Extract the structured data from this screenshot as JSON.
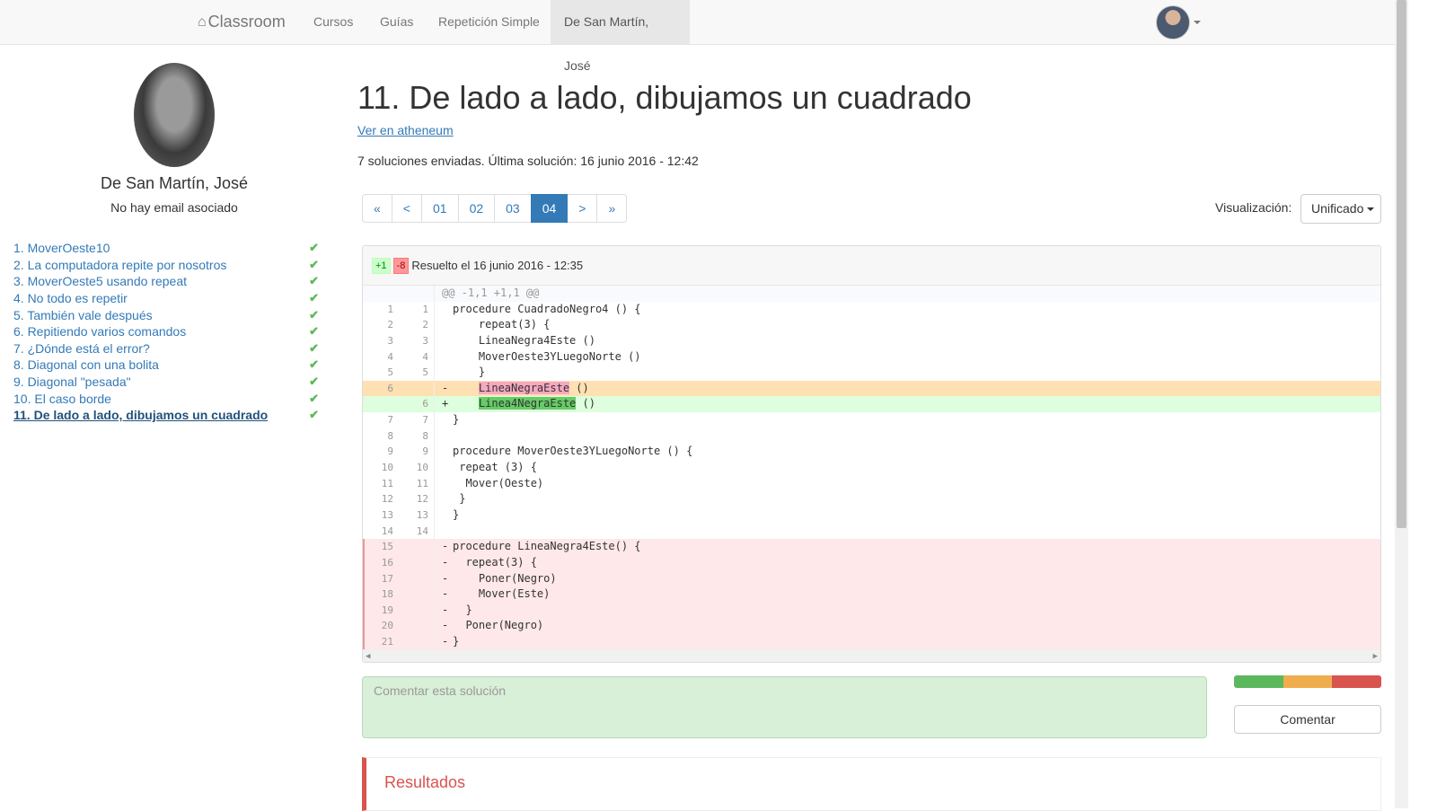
{
  "navbar": {
    "brand": "Classroom",
    "items": [
      "Cursos",
      "Guías",
      "Repetición Simple",
      "De San Martín, José"
    ]
  },
  "profile": {
    "name": "De San Martín, José",
    "email": "No hay email asociado"
  },
  "exercises": [
    "1. MoverOeste10",
    "2. La computadora repite por nosotros",
    "3. MoverOeste5 usando repeat",
    "4. No todo es repetir",
    "5. También vale después",
    "6. Repitiendo varios comandos",
    "7. ¿Dónde está el error?",
    "8. Diagonal con una bolita",
    "9. Diagonal \"pesada\"",
    "10. El caso borde",
    "11. De lado a lado, dibujamos un cuadrado"
  ],
  "main": {
    "title": "11. De lado a lado, dibujamos un cuadrado",
    "atheneum_link": "Ver en atheneum",
    "summary": "7 soluciones enviadas. Última solución: 16 junio 2016 - 12:42",
    "pager": [
      "«",
      "<",
      "01",
      "02",
      "03",
      "04",
      ">",
      "»"
    ],
    "visualization_label": "Visualización:",
    "visualization_value": "Unificado"
  },
  "diff": {
    "added": "+1",
    "removed": "-8",
    "resolved": "Resuelto el 16 junio 2016 - 12:35",
    "hunk": "@@ -1,1 +1,1 @@",
    "lines": [
      {
        "n1": "1",
        "n2": "1",
        "sign": "",
        "code": "procedure CuadradoNegro4 () {"
      },
      {
        "n1": "2",
        "n2": "2",
        "sign": "",
        "code": "    repeat(3) {"
      },
      {
        "n1": "3",
        "n2": "3",
        "sign": "",
        "code": "    LineaNegra4Este ()"
      },
      {
        "n1": "4",
        "n2": "4",
        "sign": "",
        "code": "    MoverOeste3YLuegoNorte ()"
      },
      {
        "n1": "5",
        "n2": "5",
        "sign": "",
        "code": "    }"
      },
      {
        "n1": "6",
        "n2": "",
        "sign": "-",
        "code": "    LineaNegraEste ()"
      },
      {
        "n1": "",
        "n2": "6",
        "sign": "+",
        "code": "    Linea4NegraEste ()"
      },
      {
        "n1": "7",
        "n2": "7",
        "sign": "",
        "code": "}"
      },
      {
        "n1": "8",
        "n2": "8",
        "sign": "",
        "code": ""
      },
      {
        "n1": "9",
        "n2": "9",
        "sign": "",
        "code": "procedure MoverOeste3YLuegoNorte () {"
      },
      {
        "n1": "10",
        "n2": "10",
        "sign": "",
        "code": " repeat (3) {"
      },
      {
        "n1": "11",
        "n2": "11",
        "sign": "",
        "code": "  Mover(Oeste)"
      },
      {
        "n1": "12",
        "n2": "12",
        "sign": "",
        "code": " }"
      },
      {
        "n1": "13",
        "n2": "13",
        "sign": "",
        "code": "}"
      },
      {
        "n1": "14",
        "n2": "14",
        "sign": "",
        "code": ""
      },
      {
        "n1": "15",
        "n2": "",
        "sign": "-",
        "code": "procedure LineaNegra4Este() {"
      },
      {
        "n1": "16",
        "n2": "",
        "sign": "-",
        "code": "  repeat(3) {"
      },
      {
        "n1": "17",
        "n2": "",
        "sign": "-",
        "code": "    Poner(Negro)"
      },
      {
        "n1": "18",
        "n2": "",
        "sign": "-",
        "code": "    Mover(Este)"
      },
      {
        "n1": "19",
        "n2": "",
        "sign": "-",
        "code": "  }"
      },
      {
        "n1": "20",
        "n2": "",
        "sign": "-",
        "code": "  Poner(Negro)"
      },
      {
        "n1": "21",
        "n2": "",
        "sign": "-",
        "code": "}"
      }
    ]
  },
  "comment": {
    "placeholder": "Comentar esta solución",
    "button": "Comentar"
  },
  "results": {
    "title": "Resultados"
  },
  "colors": {
    "link": "#337ab7",
    "success": "#5cb85c",
    "warning": "#f0ad4e",
    "danger": "#d9534f"
  }
}
